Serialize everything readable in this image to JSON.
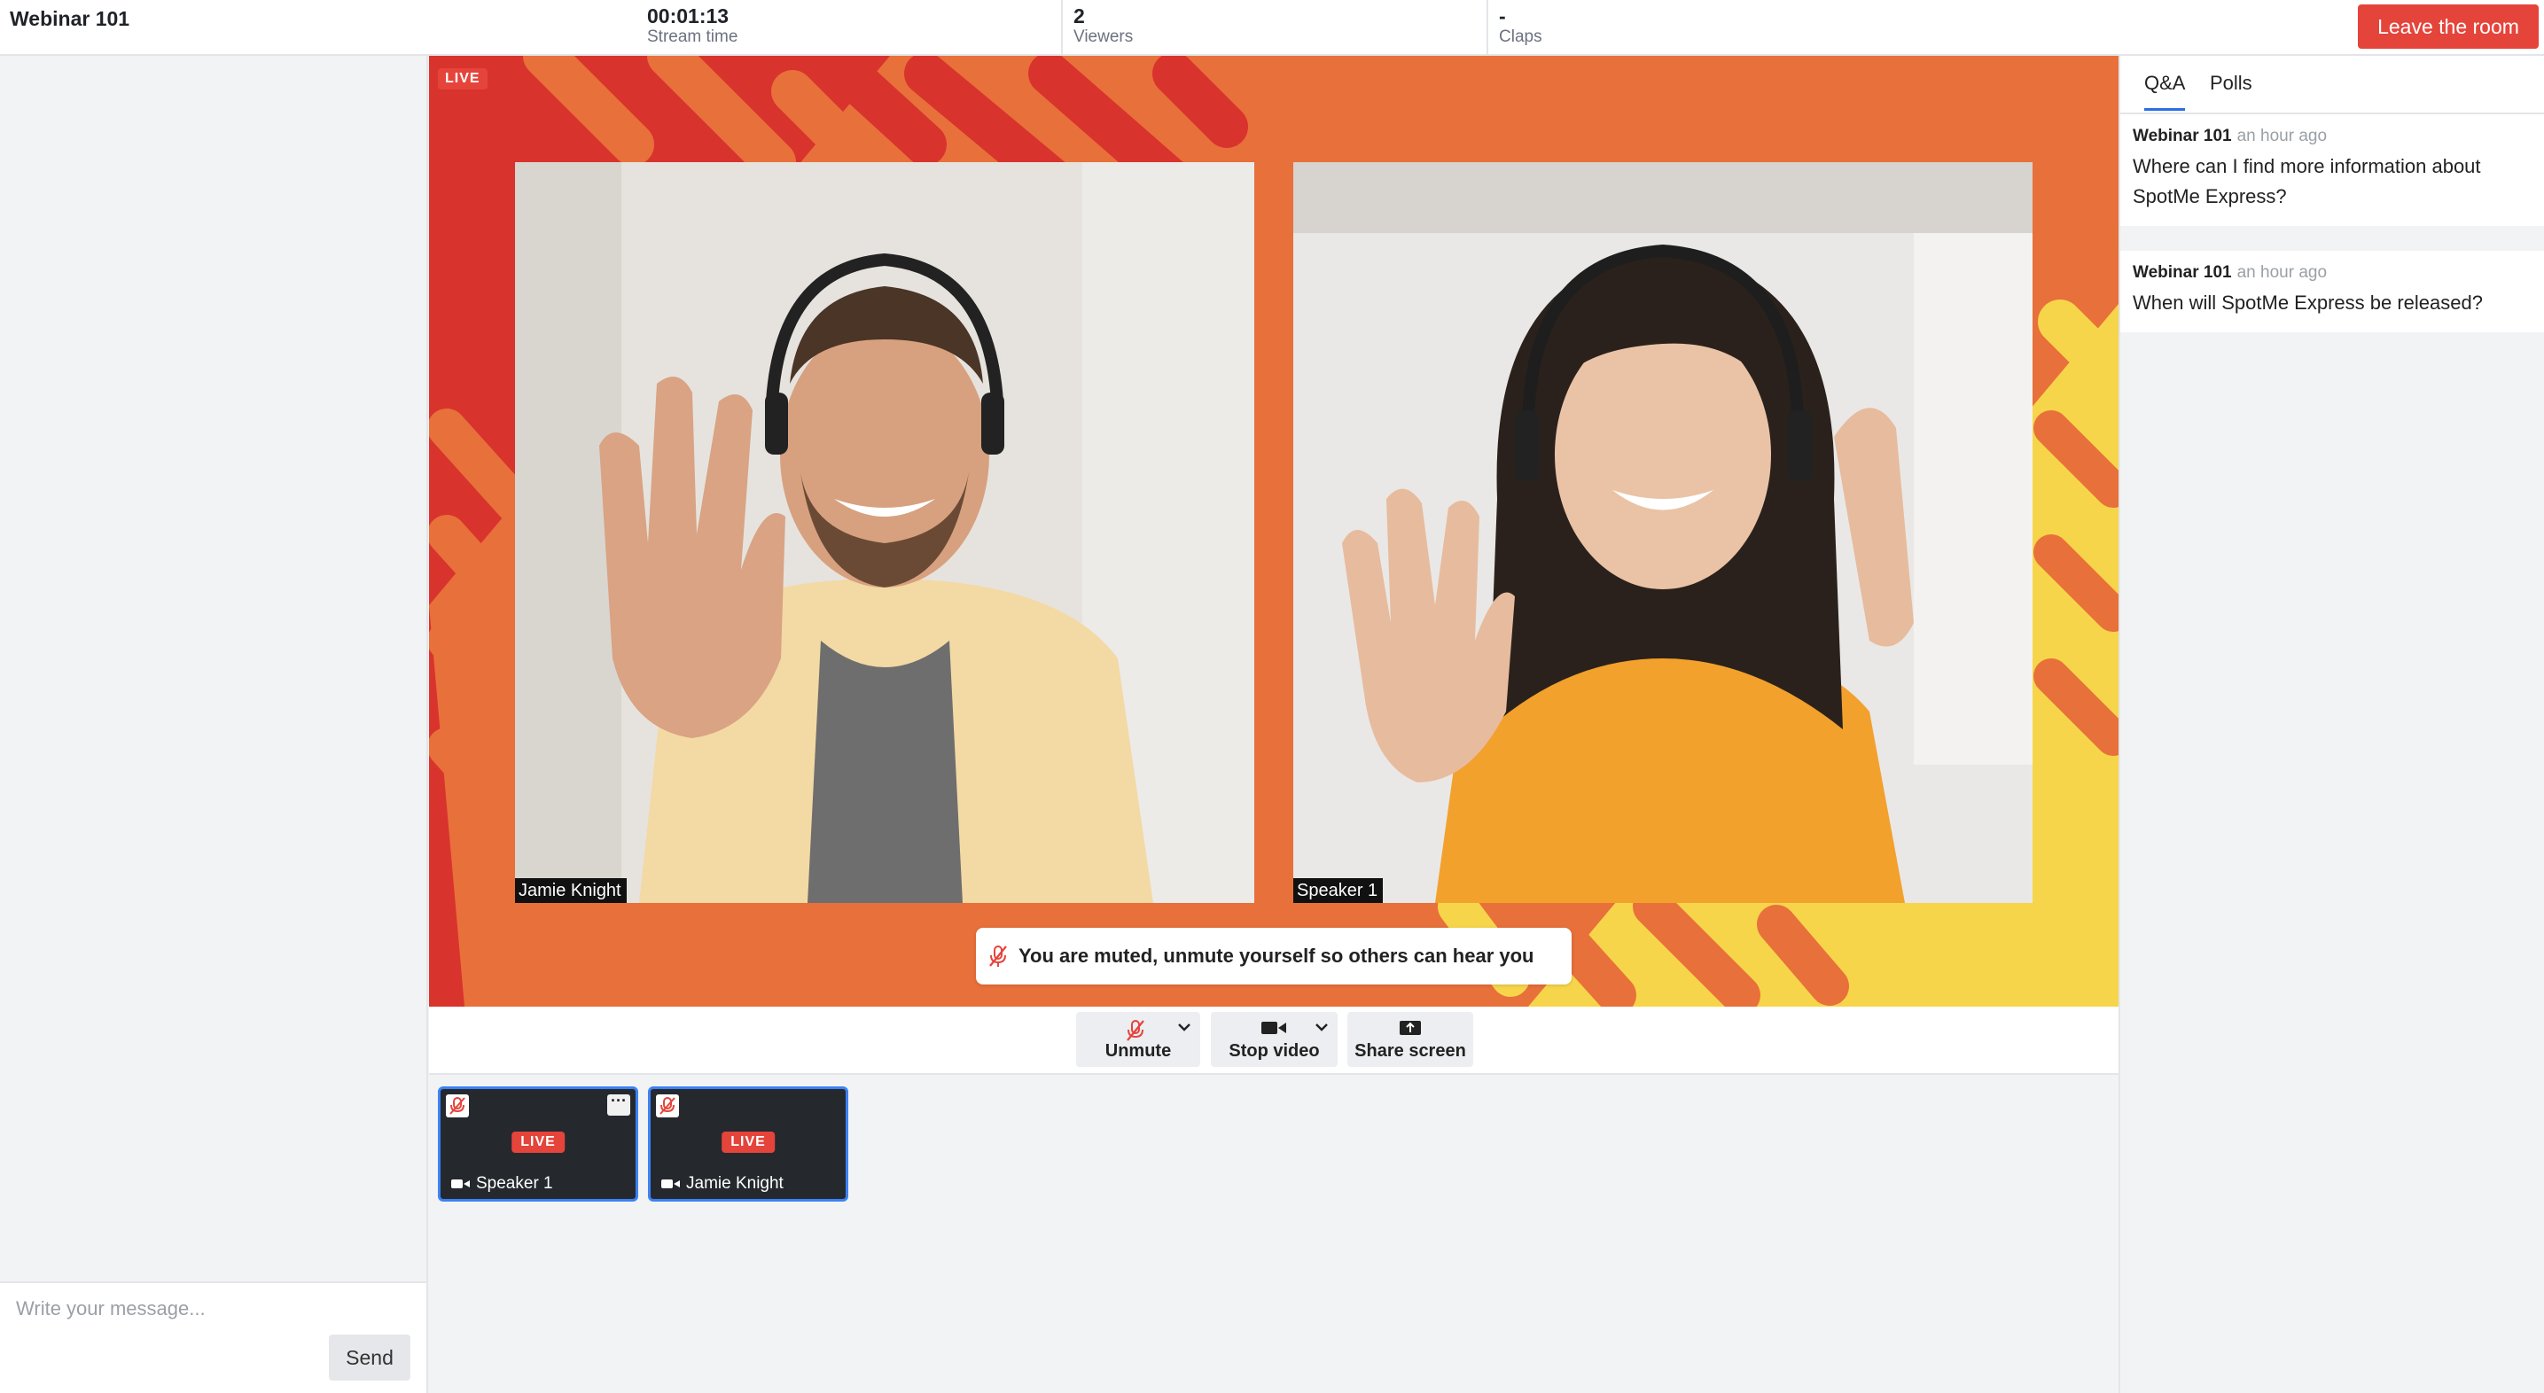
{
  "header": {
    "title": "Webinar 101",
    "stats": [
      {
        "value": "00:01:13",
        "label": "Stream time"
      },
      {
        "value": "2",
        "label": "Viewers"
      },
      {
        "value": "-",
        "label": "Claps"
      }
    ],
    "leave_label": "Leave the room"
  },
  "chat": {
    "placeholder": "Write your message...",
    "send_label": "Send"
  },
  "stage": {
    "live_label": "LIVE",
    "tiles": [
      {
        "name": "Jamie Knight"
      },
      {
        "name": "Speaker 1"
      }
    ],
    "muted_notice": "You are muted, unmute yourself so others can hear you"
  },
  "controls": {
    "unmute_label": "Unmute",
    "stop_video_label": "Stop video",
    "share_screen_label": "Share screen"
  },
  "participants": [
    {
      "name": "Speaker 1",
      "live": "LIVE",
      "more": "···"
    },
    {
      "name": "Jamie Knight",
      "live": "LIVE"
    }
  ],
  "sidepanel": {
    "tabs": [
      {
        "label": "Q&A",
        "active": true
      },
      {
        "label": "Polls",
        "active": false
      }
    ],
    "questions": [
      {
        "author": "Webinar 101",
        "time": "an hour ago",
        "text": "Where can I find more information about SpotMe Express?"
      },
      {
        "author": "Webinar 101",
        "time": "an hour ago",
        "text": "When will SpotMe Express be released?"
      }
    ]
  },
  "colors": {
    "accent_red": "#e5443b",
    "stage_orange": "#e8703a",
    "stage_red": "#d9332d",
    "stage_yellow": "#f7d54a",
    "tab_underline": "#2b6de5",
    "thumb_border": "#3b82f6"
  }
}
